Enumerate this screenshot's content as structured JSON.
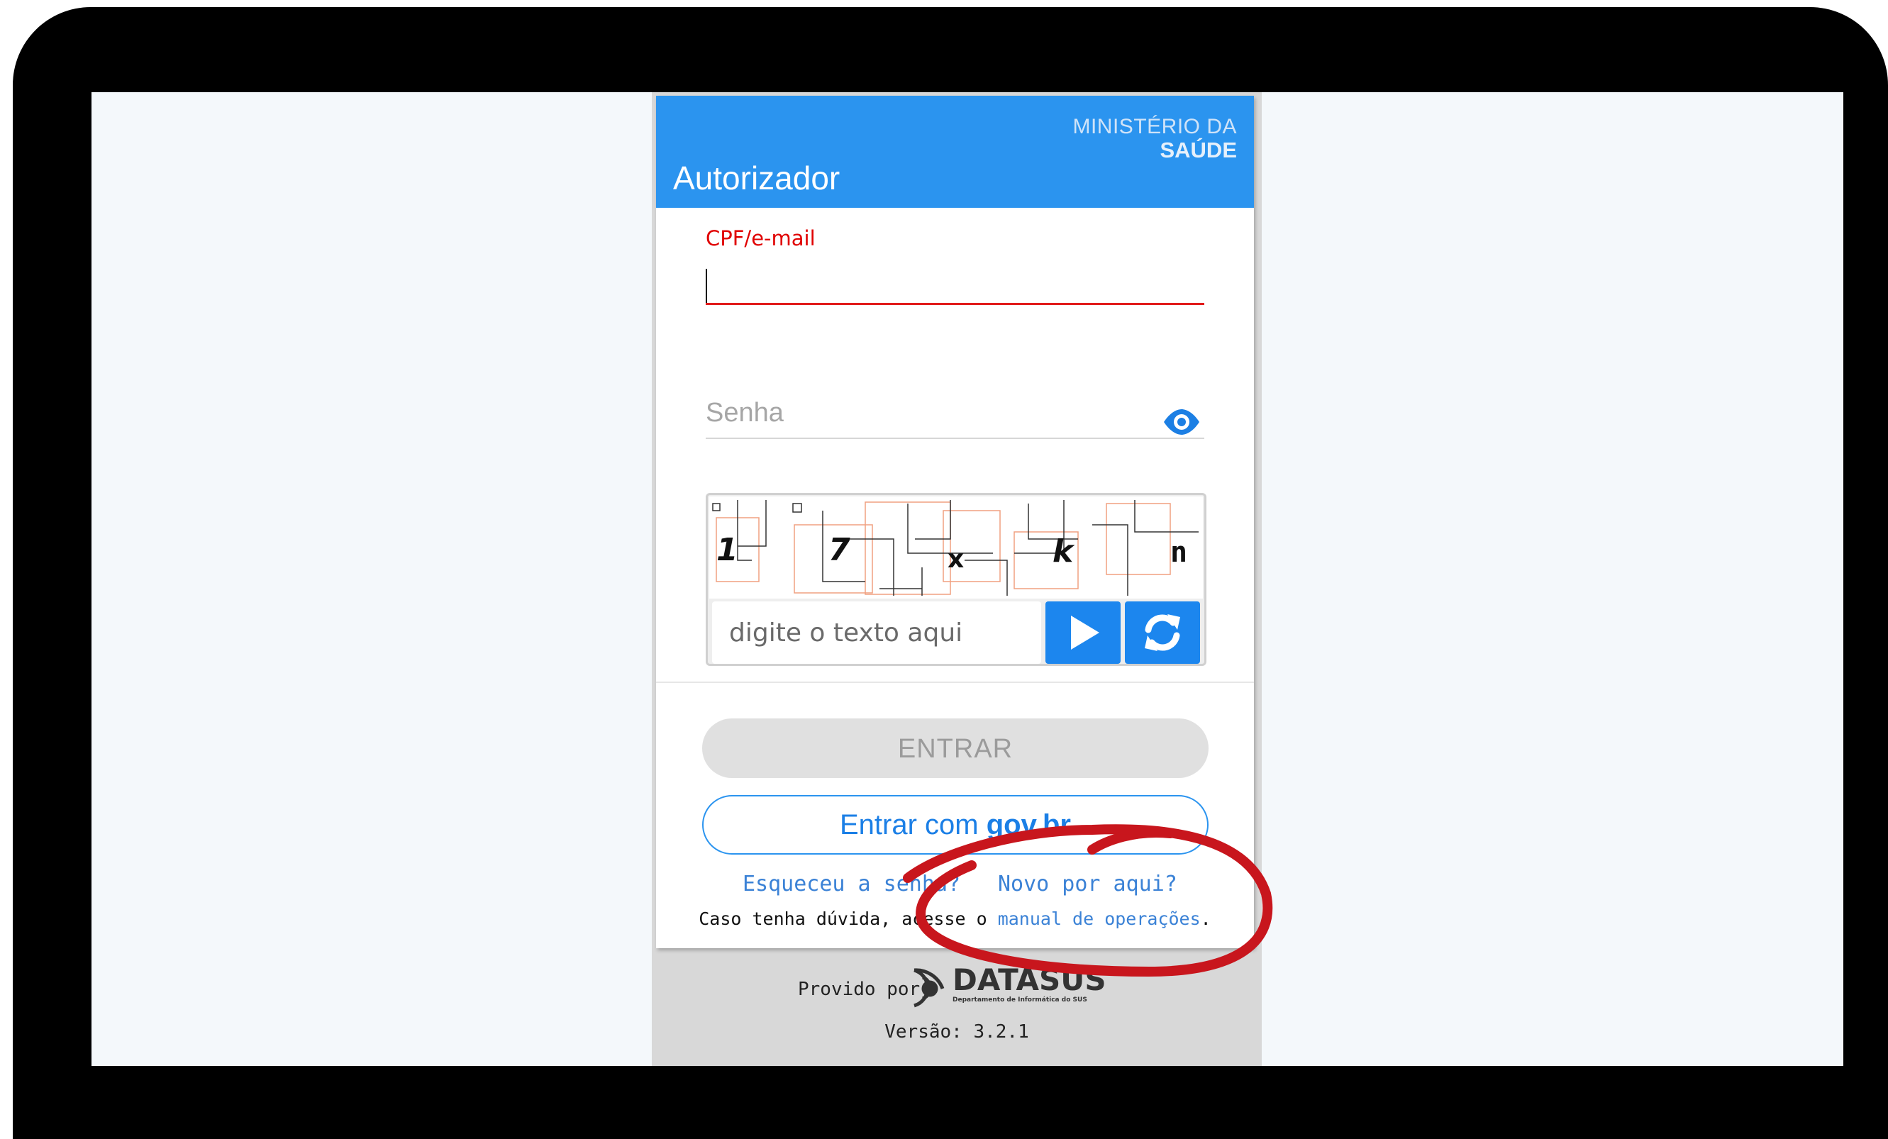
{
  "header": {
    "brand_line1": "MINISTÉRIO DA",
    "brand_line2": "SAÚDE",
    "title": "Autorizador"
  },
  "login": {
    "cpf_label": "CPF/e-mail",
    "cpf_value": "",
    "password_placeholder": "Senha",
    "password_value": ""
  },
  "captcha": {
    "characters": [
      "1",
      "7",
      "x",
      "k",
      "n"
    ],
    "input_placeholder": "digite o texto aqui",
    "play_icon": "play-icon",
    "refresh_icon": "refresh-icon"
  },
  "actions": {
    "entrar_label": "ENTRAR",
    "gov_prefix": "Entrar com ",
    "gov_brand": "gov.br",
    "forgot_link": "Esqueceu a senha?",
    "new_link": "Novo por aqui?",
    "help_prefix": "Caso tenha dúvida, acesse o ",
    "help_link": "manual de operações",
    "help_suffix": "."
  },
  "footer": {
    "provided_by": "Provido por",
    "logo_name": "DATASUS",
    "logo_subtitle": "Departamento de Informática do SUS",
    "version": "Versão: 3.2.1"
  },
  "colors": {
    "header_blue": "#2b94ef",
    "error_red": "#e11a1a",
    "button_blue": "#1c86ee",
    "annotation_red": "#c8161d"
  }
}
